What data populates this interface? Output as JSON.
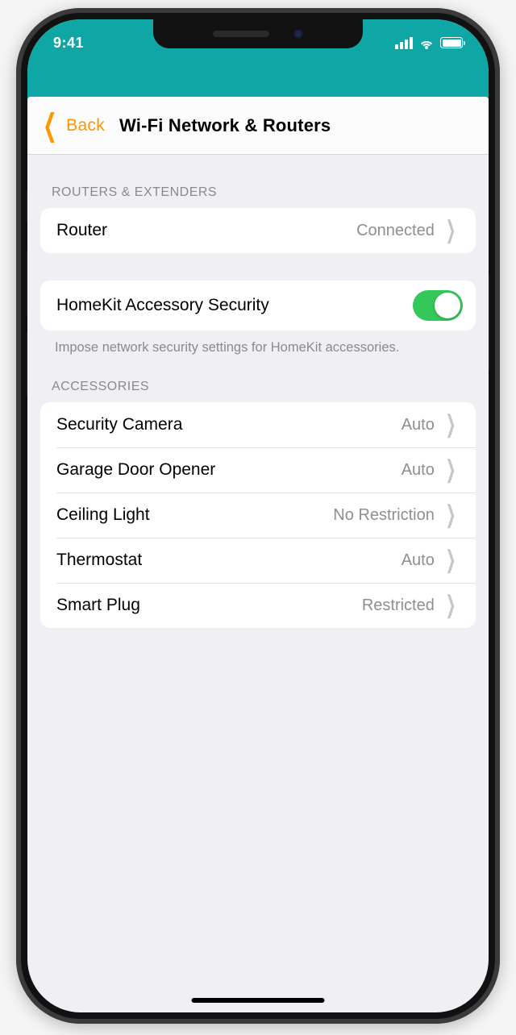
{
  "status": {
    "time": "9:41"
  },
  "nav": {
    "back": "Back",
    "title": "Wi-Fi Network & Routers"
  },
  "sections": {
    "routers_header": "ROUTERS & EXTENDERS",
    "accessories_header": "ACCESSORIES"
  },
  "router_row": {
    "label": "Router",
    "value": "Connected"
  },
  "security_row": {
    "label": "HomeKit Accessory Security",
    "on": true
  },
  "security_footer": "Impose network security settings for HomeKit accessories.",
  "accessories": [
    {
      "label": "Security Camera",
      "value": "Auto"
    },
    {
      "label": "Garage Door Opener",
      "value": "Auto"
    },
    {
      "label": "Ceiling Light",
      "value": "No Restriction"
    },
    {
      "label": "Thermostat",
      "value": "Auto"
    },
    {
      "label": "Smart Plug",
      "value": "Restricted"
    }
  ]
}
